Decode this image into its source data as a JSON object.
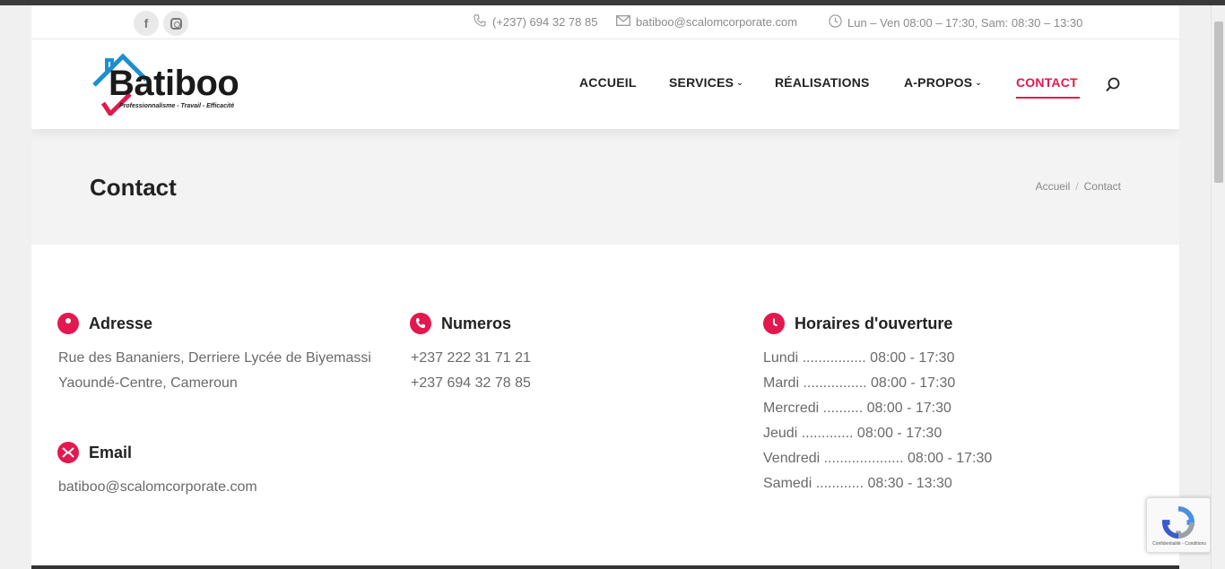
{
  "topbar": {
    "social": [
      {
        "name": "facebook-icon",
        "glyph": "f"
      },
      {
        "name": "instagram-icon"
      }
    ],
    "phone": "(+237) 694 32 78 85",
    "email": "batiboo@scalomcorporate.com",
    "hours": "Lun – Ven 08:00 – 17:30, Sam: 08:30 – 13:30"
  },
  "header": {
    "logo_word": "Batiboo",
    "logo_tagline": "Professionnalisme - Travail - Efficacité",
    "nav": {
      "accueil": "ACCUEIL",
      "services": "SERVICES",
      "realisations": "RÉALISATIONS",
      "apropos": "A-PROPOS",
      "contact": "CONTACT"
    },
    "active_color": "#e3184e"
  },
  "title_band": {
    "title": "Contact",
    "breadcrumb": [
      "Accueil",
      "/",
      "Contact"
    ]
  },
  "contact": {
    "adresse": {
      "heading": "Adresse",
      "lines": [
        "Rue des Bananiers, Derriere Lycée de Biyemassi",
        "Yaoundé-Centre, Cameroun"
      ]
    },
    "numeros": {
      "heading": "Numeros",
      "lines": [
        "+237 222 31 71 21",
        "+237 694 32 78 85"
      ]
    },
    "horaires": {
      "heading": "Horaires d'ouverture",
      "lines": [
        "Lundi ................ 08:00 - 17:30",
        "Mardi ................ 08:00 - 17:30",
        "Mercredi .......... 08:00 - 17:30",
        "Jeudi ............. 08:00 - 17:30",
        "Vendredi .................... 08:00 - 17:30",
        "Samedi ............ 08:30 - 13:30"
      ]
    },
    "email": {
      "heading": "Email",
      "value": "batiboo@scalomcorporate.com"
    }
  },
  "recaptcha": {
    "text": "Confidentialité - Conditions"
  }
}
